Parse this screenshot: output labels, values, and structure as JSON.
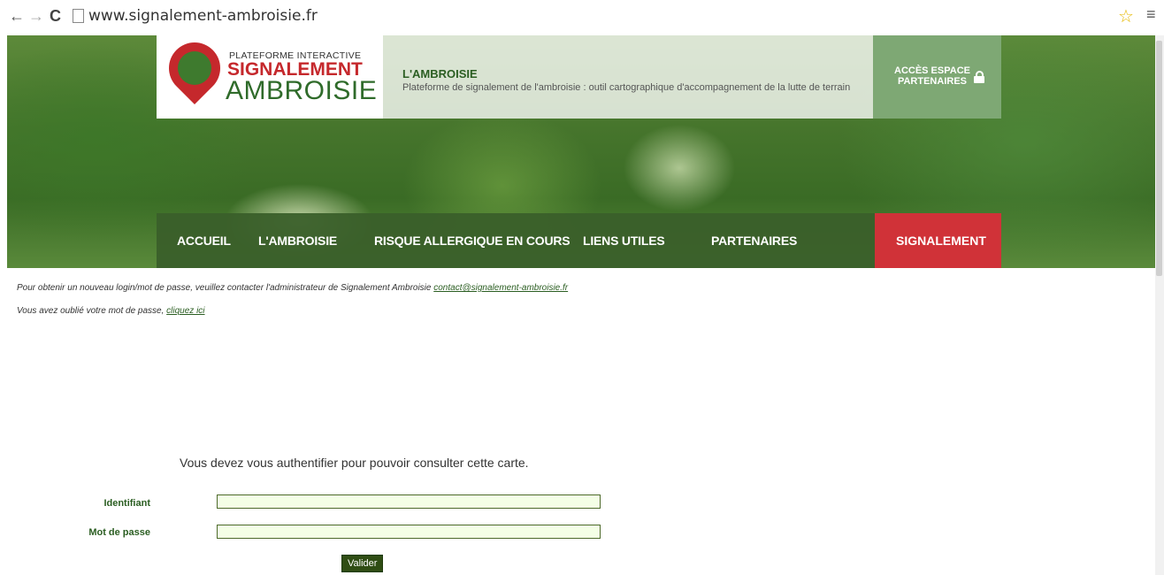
{
  "browser": {
    "url": "www.signalement-ambroisie.fr"
  },
  "header": {
    "logo": {
      "line1": "PLATEFORME INTERACTIVE",
      "line2": "SIGNALEMENT",
      "line3": "AMBROISIE"
    },
    "title": "L'AMBROISIE",
    "subtitle": "Plateforme de signalement de l'ambroisie : outil cartographique d'accompagnement de la lutte de terrain",
    "partners_line1": "ACCÈS ESPACE",
    "partners_line2": "PARTENAIRES"
  },
  "nav": {
    "items": [
      "ACCUEIL",
      "L'AMBROISIE",
      "RISQUE ALLERGIQUE EN COURS",
      "LIENS UTILES",
      "PARTENAIRES"
    ],
    "signalement": "SIGNALEMENT"
  },
  "info": {
    "login_text": "Pour obtenir un nouveau login/mot de passe, veuillez contacter l'administrateur de Signalement Ambroisie ",
    "contact_email": "contact@signalement-ambroisie.fr",
    "forgot_text": "Vous avez oublié votre mot de passe, ",
    "forgot_link": "cliquez ici"
  },
  "auth": {
    "message": "Vous devez vous authentifier pour pouvoir consulter cette carte.",
    "identifier_label": "Identifiant",
    "password_label": "Mot de passe",
    "identifier_value": "",
    "password_value": "",
    "submit_label": "Valider"
  }
}
